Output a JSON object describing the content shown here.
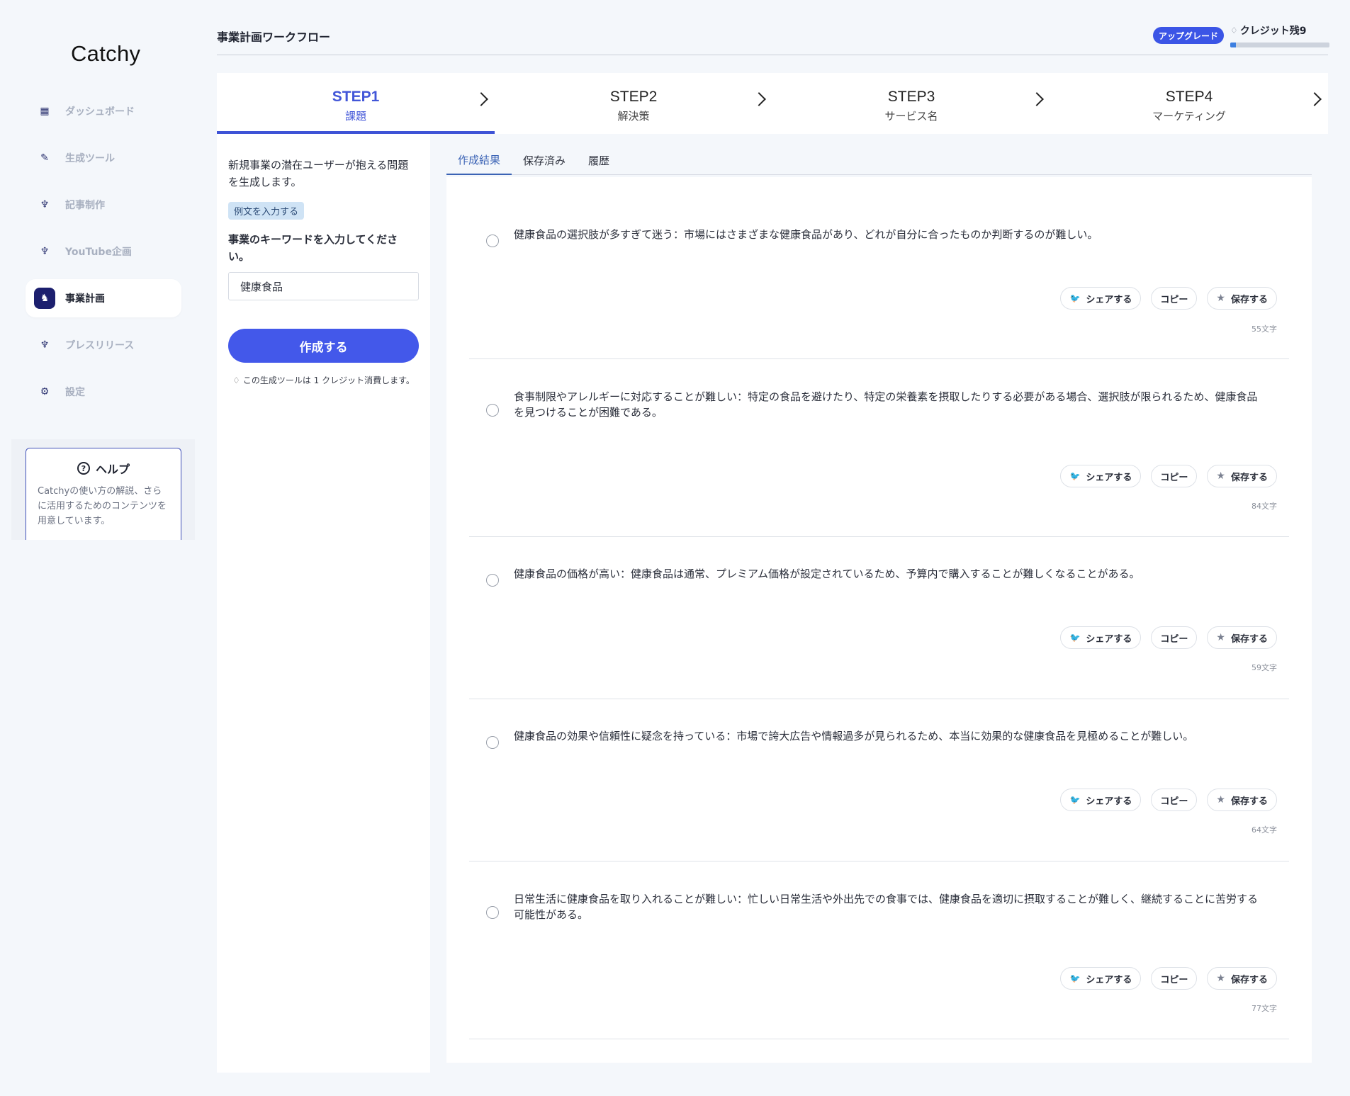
{
  "app": {
    "logo": "Catchy"
  },
  "sidebar": {
    "items": [
      {
        "label": "ダッシュボード",
        "icon": "grid-icon",
        "glyph": "▦"
      },
      {
        "label": "生成ツール",
        "icon": "wrench-icon",
        "glyph": "✎"
      },
      {
        "label": "記事制作",
        "icon": "genie-lamp-icon",
        "glyph": "♆"
      },
      {
        "label": "YouTube企画",
        "icon": "genie-lamp-icon",
        "glyph": "♆"
      },
      {
        "label": "事業計画",
        "icon": "unicorn-icon",
        "glyph": "♞",
        "active": true
      },
      {
        "label": "プレスリリース",
        "icon": "genie-lamp-icon",
        "glyph": "♆"
      },
      {
        "label": "設定",
        "icon": "gear-icon",
        "glyph": "⚙"
      }
    ],
    "help": {
      "title": "ヘルプ",
      "description": "Catchyの使い方の解説、さらに活用するためのコンテンツを用意しています。"
    }
  },
  "header": {
    "title": "事業計画ワークフロー",
    "upgrade_label": "アップグレード",
    "credits_label": "クレジット残9",
    "credit_fraction": 0.06
  },
  "steps": [
    {
      "num": "STEP1",
      "label": "課題",
      "active": true
    },
    {
      "num": "STEP2",
      "label": "解決策"
    },
    {
      "num": "STEP3",
      "label": "サービス名"
    },
    {
      "num": "STEP4",
      "label": "マーケティング"
    }
  ],
  "form": {
    "description": "新規事業の潜在ユーザーが抱える問題を生成します。",
    "example_label": "例文を入力する",
    "keyword_label": "事業のキーワードを入力してください。",
    "keyword_value": "健康食品",
    "create_label": "作成する",
    "credit_note": "この生成ツールは 1 クレジット消費します。"
  },
  "tabs": [
    "作成結果",
    "保存済み",
    "履歴"
  ],
  "actions": {
    "share": "シェアする",
    "copy": "コピー",
    "save": "保存する"
  },
  "results": [
    {
      "text": "健康食品の選択肢が多すぎて迷う：市場にはさまざまな健康食品があり、どれが自分に合ったものか判断するのが難しい。",
      "count": "55文字"
    },
    {
      "text": "食事制限やアレルギーに対応することが難しい：特定の食品を避けたり、特定の栄養素を摂取したりする必要がある場合、選択肢が限られるため、健康食品を見つけることが困難である。",
      "count": "84文字"
    },
    {
      "text": "健康食品の価格が高い：健康食品は通常、プレミアム価格が設定されているため、予算内で購入することが難しくなることがある。",
      "count": "59文字"
    },
    {
      "text": "健康食品の効果や信頼性に疑念を持っている：市場で誇大広告や情報過多が見られるため、本当に効果的な健康食品を見極めることが難しい。",
      "count": "64文字"
    },
    {
      "text": "日常生活に健康食品を取り入れることが難しい：忙しい日常生活や外出先での食事では、健康食品を適切に摂取することが難しく、継続することに苦労する可能性がある。",
      "count": "77文字"
    }
  ]
}
